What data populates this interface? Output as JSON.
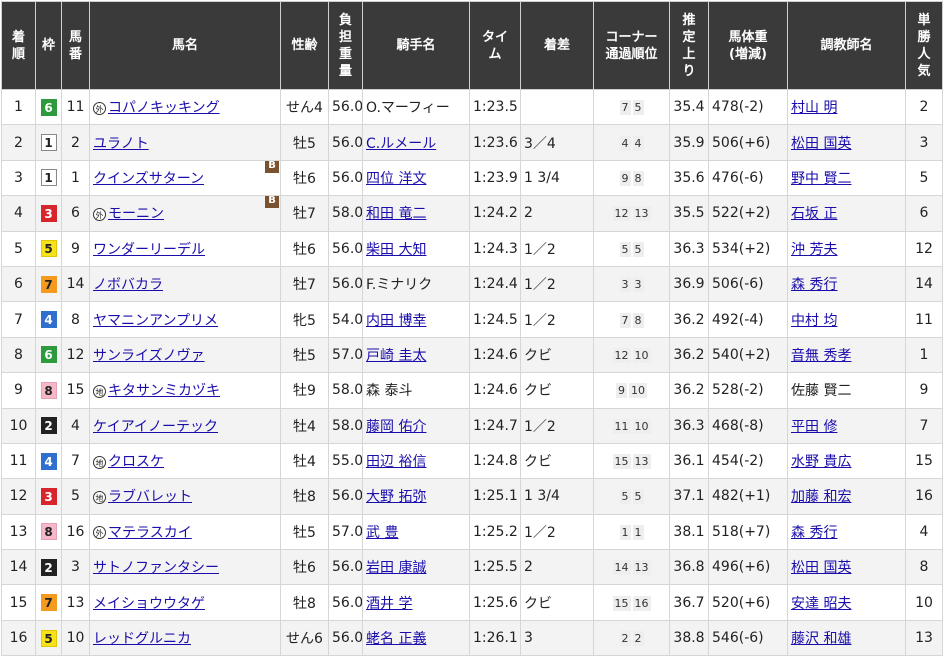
{
  "headers": {
    "rank": "着順",
    "waku": "枠",
    "umaban": "馬番",
    "horse": "馬名",
    "sexage": "性齢",
    "weight": "負担重量",
    "jockey": "騎手名",
    "time": "タイム",
    "margin": "着差",
    "corner_l1": "コーナー",
    "corner_l2": "通過順位",
    "last3f": "推定上り",
    "bw_l1": "馬体重",
    "bw_l2": "(増減)",
    "trainer": "調教師名",
    "pop": "単勝人気"
  },
  "waku_colors": {
    "1": {
      "bg": "#ffffff",
      "fg": "#222222",
      "border": "#888888"
    },
    "2": {
      "bg": "#222222",
      "fg": "#ffffff",
      "border": "#222222"
    },
    "3": {
      "bg": "#d7262b",
      "fg": "#ffffff",
      "border": "#d7262b"
    },
    "4": {
      "bg": "#2f6fd0",
      "fg": "#ffffff",
      "border": "#2f6fd0"
    },
    "5": {
      "bg": "#f5e21a",
      "fg": "#222222",
      "border": "#e0c800"
    },
    "6": {
      "bg": "#2e9a3e",
      "fg": "#ffffff",
      "border": "#2e9a3e"
    },
    "7": {
      "bg": "#f39a1f",
      "fg": "#222222",
      "border": "#f39a1f"
    },
    "8": {
      "bg": "#f5b8c8",
      "fg": "#222222",
      "border": "#e8a0b4"
    }
  },
  "rows": [
    {
      "rank": "1",
      "waku": "6",
      "umaban": "11",
      "mark": "外",
      "horse": "コパノキッキング",
      "blinker": "",
      "sexage": "せん4",
      "weight": "56.0",
      "jockey": "O.マーフィー",
      "jockey_link": false,
      "time": "1:23.5",
      "margin": "",
      "corners": [
        "7",
        "5"
      ],
      "last3f": "35.4",
      "bw": "478",
      "bwd": "(-2)",
      "trainer": "村山 明",
      "trainer_link": true,
      "pop": "2"
    },
    {
      "rank": "2",
      "waku": "1",
      "umaban": "2",
      "mark": "",
      "horse": "ユラノト",
      "blinker": "",
      "sexage": "牡5",
      "weight": "56.0",
      "jockey": "C.ルメール",
      "jockey_link": true,
      "time": "1:23.6",
      "margin": "3／4",
      "corners": [
        "4",
        "4"
      ],
      "last3f": "35.9",
      "bw": "506",
      "bwd": "(+6)",
      "trainer": "松田 国英",
      "trainer_link": true,
      "pop": "3"
    },
    {
      "rank": "3",
      "waku": "1",
      "umaban": "1",
      "mark": "",
      "horse": "クインズサターン",
      "blinker": "B",
      "sexage": "牡6",
      "weight": "56.0",
      "jockey": "四位 洋文",
      "jockey_link": true,
      "time": "1:23.9",
      "margin": "1 3/4",
      "corners": [
        "9",
        "8"
      ],
      "last3f": "35.6",
      "bw": "476",
      "bwd": "(-6)",
      "trainer": "野中 賢二",
      "trainer_link": true,
      "pop": "5"
    },
    {
      "rank": "4",
      "waku": "3",
      "umaban": "6",
      "mark": "外",
      "horse": "モーニン",
      "blinker": "B",
      "sexage": "牡7",
      "weight": "58.0",
      "jockey": "和田 竜二",
      "jockey_link": true,
      "time": "1:24.2",
      "margin": "2",
      "corners": [
        "12",
        "13"
      ],
      "last3f": "35.5",
      "bw": "522",
      "bwd": "(+2)",
      "trainer": "石坂 正",
      "trainer_link": true,
      "pop": "6"
    },
    {
      "rank": "5",
      "waku": "5",
      "umaban": "9",
      "mark": "",
      "horse": "ワンダーリーデル",
      "blinker": "",
      "sexage": "牡6",
      "weight": "56.0",
      "jockey": "柴田 大知",
      "jockey_link": true,
      "time": "1:24.3",
      "margin": "1／2",
      "corners": [
        "5",
        "5"
      ],
      "last3f": "36.3",
      "bw": "534",
      "bwd": "(+2)",
      "trainer": "沖 芳夫",
      "trainer_link": true,
      "pop": "12"
    },
    {
      "rank": "6",
      "waku": "7",
      "umaban": "14",
      "mark": "",
      "horse": "ノボバカラ",
      "blinker": "",
      "sexage": "牡7",
      "weight": "56.0",
      "jockey": "F.ミナリク",
      "jockey_link": false,
      "time": "1:24.4",
      "margin": "1／2",
      "corners": [
        "3",
        "3"
      ],
      "last3f": "36.9",
      "bw": "506",
      "bwd": "(-6)",
      "trainer": "森 秀行",
      "trainer_link": true,
      "pop": "14"
    },
    {
      "rank": "7",
      "waku": "4",
      "umaban": "8",
      "mark": "",
      "horse": "ヤマニンアンプリメ",
      "blinker": "",
      "sexage": "牝5",
      "weight": "54.0",
      "jockey": "内田 博幸",
      "jockey_link": true,
      "time": "1:24.5",
      "margin": "1／2",
      "corners": [
        "7",
        "8"
      ],
      "last3f": "36.2",
      "bw": "492",
      "bwd": "(-4)",
      "trainer": "中村 均",
      "trainer_link": true,
      "pop": "11"
    },
    {
      "rank": "8",
      "waku": "6",
      "umaban": "12",
      "mark": "",
      "horse": "サンライズノヴァ",
      "blinker": "",
      "sexage": "牡5",
      "weight": "57.0",
      "jockey": "戸崎 圭太",
      "jockey_link": true,
      "time": "1:24.6",
      "margin": "クビ",
      "corners": [
        "12",
        "10"
      ],
      "last3f": "36.2",
      "bw": "540",
      "bwd": "(+2)",
      "trainer": "音無 秀孝",
      "trainer_link": true,
      "pop": "1"
    },
    {
      "rank": "9",
      "waku": "8",
      "umaban": "15",
      "mark": "地",
      "horse": "キタサンミカヅキ",
      "blinker": "",
      "sexage": "牡9",
      "weight": "58.0",
      "jockey": "森 泰斗",
      "jockey_link": false,
      "time": "1:24.6",
      "margin": "クビ",
      "corners": [
        "9",
        "10"
      ],
      "last3f": "36.2",
      "bw": "528",
      "bwd": "(-2)",
      "trainer": "佐藤 賢二",
      "trainer_link": false,
      "pop": "9"
    },
    {
      "rank": "10",
      "waku": "2",
      "umaban": "4",
      "mark": "",
      "horse": "ケイアイノーテック",
      "blinker": "",
      "sexage": "牡4",
      "weight": "58.0",
      "jockey": "藤岡 佑介",
      "jockey_link": true,
      "time": "1:24.7",
      "margin": "1／2",
      "corners": [
        "11",
        "10"
      ],
      "last3f": "36.3",
      "bw": "468",
      "bwd": "(-8)",
      "trainer": "平田 修",
      "trainer_link": true,
      "pop": "7"
    },
    {
      "rank": "11",
      "waku": "4",
      "umaban": "7",
      "mark": "地",
      "horse": "クロスケ",
      "blinker": "",
      "sexage": "牡4",
      "weight": "55.0",
      "jockey": "田辺 裕信",
      "jockey_link": true,
      "time": "1:24.8",
      "margin": "クビ",
      "corners": [
        "15",
        "13"
      ],
      "last3f": "36.1",
      "bw": "454",
      "bwd": "(-2)",
      "trainer": "水野 貴広",
      "trainer_link": true,
      "pop": "15"
    },
    {
      "rank": "12",
      "waku": "3",
      "umaban": "5",
      "mark": "地",
      "horse": "ラブバレット",
      "blinker": "",
      "sexage": "牡8",
      "weight": "56.0",
      "jockey": "大野 拓弥",
      "jockey_link": true,
      "time": "1:25.1",
      "margin": "1 3/4",
      "corners": [
        "5",
        "5"
      ],
      "last3f": "37.1",
      "bw": "482",
      "bwd": "(+1)",
      "trainer": "加藤 和宏",
      "trainer_link": true,
      "pop": "16"
    },
    {
      "rank": "13",
      "waku": "8",
      "umaban": "16",
      "mark": "外",
      "horse": "マテラスカイ",
      "blinker": "",
      "sexage": "牡5",
      "weight": "57.0",
      "jockey": "武 豊",
      "jockey_link": true,
      "time": "1:25.2",
      "margin": "1／2",
      "corners": [
        "1",
        "1"
      ],
      "last3f": "38.1",
      "bw": "518",
      "bwd": "(+7)",
      "trainer": "森 秀行",
      "trainer_link": true,
      "pop": "4"
    },
    {
      "rank": "14",
      "waku": "2",
      "umaban": "3",
      "mark": "",
      "horse": "サトノファンタシー",
      "blinker": "",
      "sexage": "牡6",
      "weight": "56.0",
      "jockey": "岩田 康誠",
      "jockey_link": true,
      "time": "1:25.5",
      "margin": "2",
      "corners": [
        "14",
        "13"
      ],
      "last3f": "36.8",
      "bw": "496",
      "bwd": "(+6)",
      "trainer": "松田 国英",
      "trainer_link": true,
      "pop": "8"
    },
    {
      "rank": "15",
      "waku": "7",
      "umaban": "13",
      "mark": "",
      "horse": "メイショウウタゲ",
      "blinker": "",
      "sexage": "牡8",
      "weight": "56.0",
      "jockey": "酒井 学",
      "jockey_link": true,
      "time": "1:25.6",
      "margin": "クビ",
      "corners": [
        "15",
        "16"
      ],
      "last3f": "36.7",
      "bw": "520",
      "bwd": "(+6)",
      "trainer": "安達 昭夫",
      "trainer_link": true,
      "pop": "10"
    },
    {
      "rank": "16",
      "waku": "5",
      "umaban": "10",
      "mark": "",
      "horse": "レッドグルニカ",
      "blinker": "",
      "sexage": "せん6",
      "weight": "56.0",
      "jockey": "蛯名 正義",
      "jockey_link": true,
      "time": "1:26.1",
      "margin": "3",
      "corners": [
        "2",
        "2"
      ],
      "last3f": "38.8",
      "bw": "546",
      "bwd": "(-6)",
      "trainer": "藤沢 和雄",
      "trainer_link": true,
      "pop": "13"
    }
  ]
}
